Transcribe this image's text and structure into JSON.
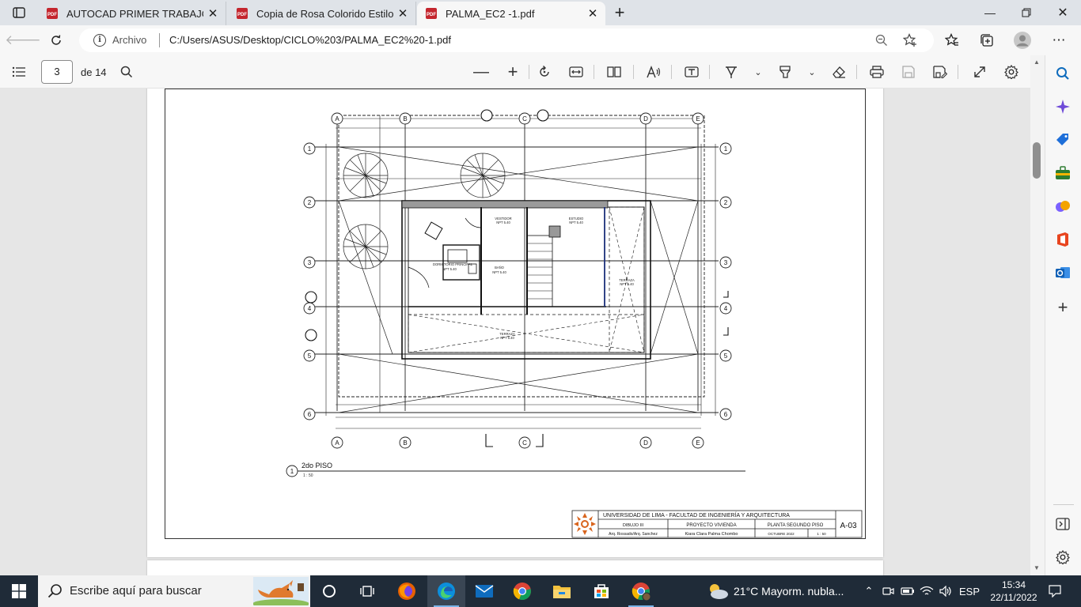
{
  "tabs": [
    {
      "title": "AUTOCAD PRIMER TRABAJO.pdf"
    },
    {
      "title": "Copia de Rosa Colorido Estilo Se"
    },
    {
      "title": "PALMA_EC2 -1.pdf"
    }
  ],
  "address": {
    "label": "Archivo",
    "url": "C:/Users/ASUS/Desktop/CICLO%203/PALMA_EC2%20-1.pdf"
  },
  "pdf_toolbar": {
    "page_current": "3",
    "page_total": "de 14"
  },
  "drawing": {
    "grid_letters": [
      "A",
      "B",
      "C",
      "D",
      "E"
    ],
    "grid_numbers": [
      "1",
      "2",
      "3",
      "4",
      "5",
      "6"
    ],
    "rooms": [
      {
        "name": "VESTIDOR",
        "level": "NPT 5.40"
      },
      {
        "name": "ESTUDIO",
        "level": "NPT 5.40"
      },
      {
        "name": "DORMITORIO PRINCIPAL",
        "level": "NPT 5.40"
      },
      {
        "name": "BAÑO",
        "level": "NPT 5.40"
      },
      {
        "name": "TERRAZA",
        "level": "NPT 5.40"
      },
      {
        "name": "TERRAZA",
        "level": "NPT 5.40"
      }
    ],
    "view_title": "2do PISO",
    "view_number": "1",
    "view_scale": "1 : 50",
    "title_block": {
      "university": "UNIVERSIDAD DE LIMA - FACULTAD DE INGENIERÍA Y ARQUITECTURA",
      "course": "DIBUJO III",
      "project": "PROYECTO VIVIENDA",
      "sheet_name": "PLANTA SEGUNDO PISO",
      "teachers": "Arq. Rossado/Arq. Sanchez",
      "student": "Kiara Clara Palma Chombo",
      "date": "OCTUBRE 2022",
      "scale": "1 : 50",
      "sheet_code": "A-03"
    }
  },
  "taskbar": {
    "search_placeholder": "Escribe aquí para buscar",
    "weather": "21°C  Mayorm. nubla...",
    "language": "ESP",
    "time": "15:34",
    "date": "22/11/2022"
  },
  "colors": {
    "tab_strip": "#dfe3e8",
    "toolbar": "#f7f7f7",
    "viewer_bg": "#e6e6e6",
    "taskbar": "#1f2b38",
    "pdf_red": "#c4262e",
    "edge_blue": "#0f6cbd"
  }
}
